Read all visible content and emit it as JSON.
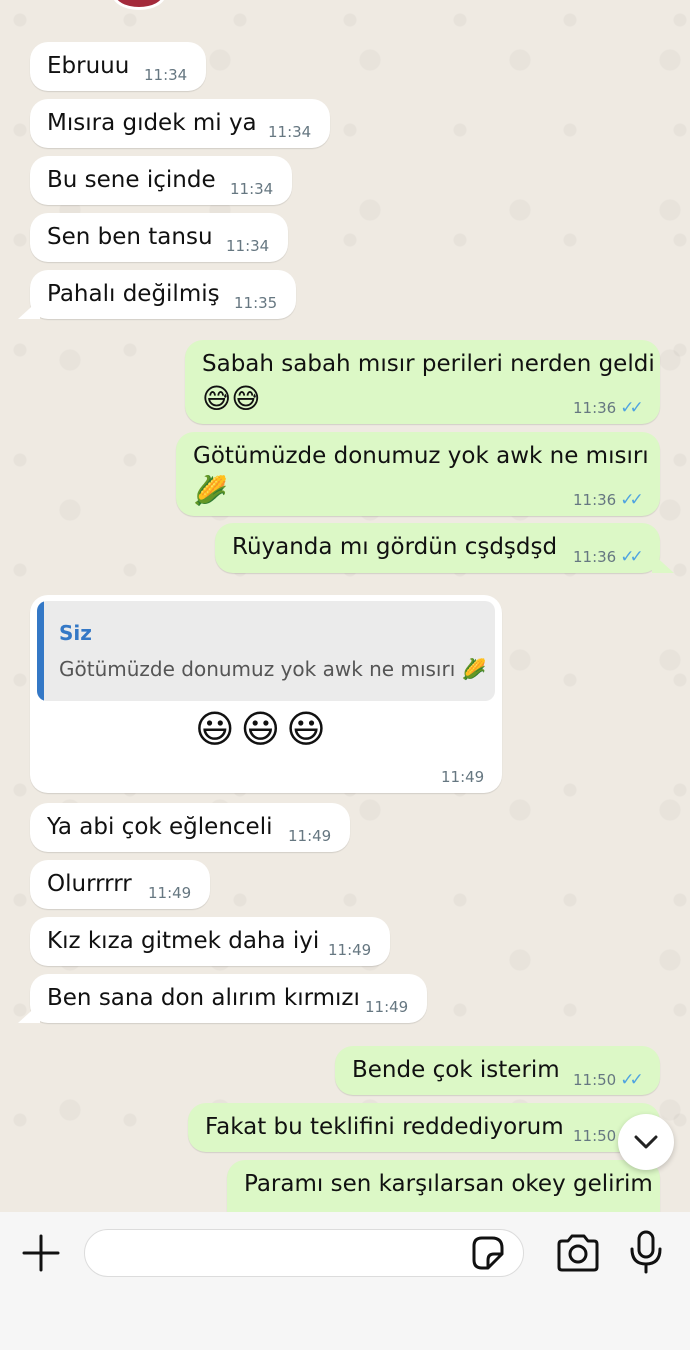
{
  "messages": [
    {
      "dir": "in",
      "text": "Ebruuu",
      "time": "11:34"
    },
    {
      "dir": "in",
      "text": "Mısıra gıdek mi ya",
      "time": "11:34"
    },
    {
      "dir": "in",
      "text": "Bu sene içinde",
      "time": "11:34"
    },
    {
      "dir": "in",
      "text": "Sen ben tansu",
      "time": "11:34"
    },
    {
      "dir": "in",
      "text": "Pahalı değilmiş",
      "time": "11:35"
    },
    {
      "dir": "out",
      "text": "Sabah sabah mısır perileri nerden geldi",
      "emoji": "😅😅",
      "time": "11:36"
    },
    {
      "dir": "out",
      "text": "Götümüzde donumuz yok awk ne mısırı",
      "emoji": "🌽",
      "time": "11:36"
    },
    {
      "dir": "out",
      "text": "Rüyanda mı gördün cşdşdşd",
      "time": "11:36"
    },
    {
      "dir": "in",
      "reply_sender": "Siz",
      "reply_text": "Götümüzde donumuz yok awk ne mısırı 🌽",
      "text": "😃😃😃",
      "time": "11:49"
    },
    {
      "dir": "in",
      "text": "Ya abi çok eğlenceli",
      "time": "11:49"
    },
    {
      "dir": "in",
      "text": "Olurrrrr",
      "time": "11:49"
    },
    {
      "dir": "in",
      "text": "Kız kıza gitmek daha iyi",
      "time": "11:49"
    },
    {
      "dir": "in",
      "text": "Ben sana don alırım kırmızı",
      "time": "11:49"
    },
    {
      "dir": "out",
      "text": "Bende çok isterim",
      "time": "11:50"
    },
    {
      "dir": "out",
      "text": "Fakat bu teklifini reddediyorum",
      "time": "11:50"
    },
    {
      "dir": "out",
      "text": "Paramı sen karşılarsan okey gelirim"
    }
  ],
  "status": {
    "read_tick": "✓✓"
  },
  "input": {
    "placeholder": ""
  },
  "icons": {
    "plus": "plus-icon",
    "sticker": "sticker-icon",
    "camera": "camera-icon",
    "mic": "microphone-icon",
    "scroll": "chevron-down-icon"
  },
  "colors": {
    "background": "#efeae2",
    "incoming_bubble": "#ffffff",
    "outgoing_bubble": "#dcf8c6",
    "read_tick": "#4fa3e0",
    "reply_accent": "#3478c6"
  }
}
